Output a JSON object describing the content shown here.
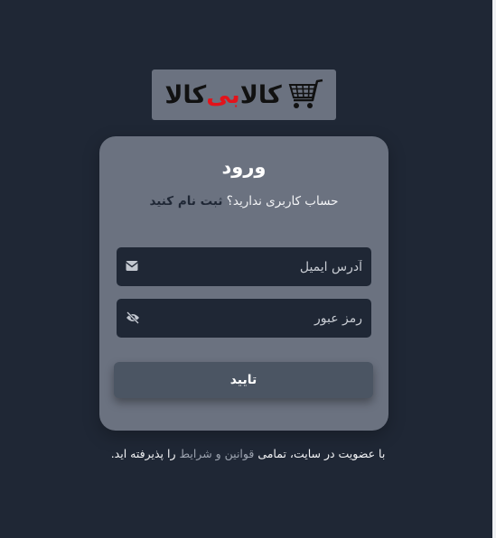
{
  "logo": {
    "text_start": "کالا",
    "text_middle": "بی",
    "text_end": "کالا",
    "accent_color": "#e3131b",
    "icon": "shopping-cart-icon"
  },
  "login": {
    "title": "ورود",
    "signup_prompt": "حساب کاربری ندارید؟",
    "signup_link": "ثبت نام کنید",
    "email_placeholder": "آدرس ایمیل",
    "email_icon": "envelope-icon",
    "password_placeholder": "رمز عبور",
    "password_icon": "eye-slash-icon",
    "submit_label": "تایید"
  },
  "footer": {
    "terms_prefix": "با عضویت در سایت، تمامی",
    "terms_link": "قوانین و شرایط",
    "terms_suffix": "را پذیرفته اید."
  },
  "colors": {
    "background": "#1f2735",
    "card": "#6b7280",
    "input": "#1f2735",
    "button": "#4b5563"
  }
}
